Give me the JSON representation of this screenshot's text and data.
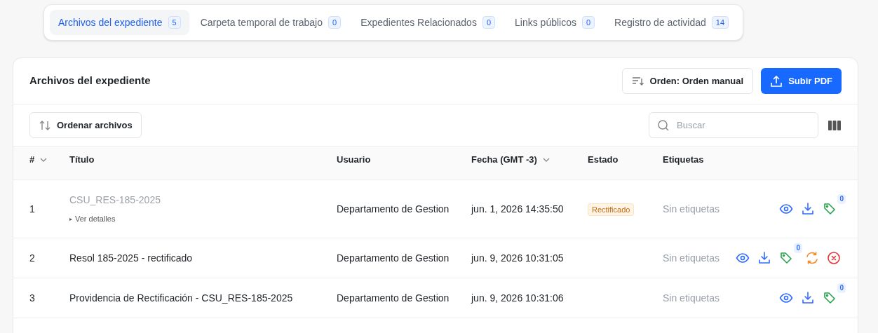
{
  "tabs": [
    {
      "label": "Archivos del expediente",
      "count": "5",
      "selected": true
    },
    {
      "label": "Carpeta temporal de trabajo",
      "count": "0",
      "selected": false
    },
    {
      "label": "Expedientes Relacionados",
      "count": "0",
      "selected": false
    },
    {
      "label": "Links públicos",
      "count": "0",
      "selected": false
    },
    {
      "label": "Registro de actividad",
      "count": "14",
      "selected": false
    }
  ],
  "panel": {
    "title": "Archivos del expediente",
    "order_button": "Orden: Orden manual",
    "upload_button": "Subir PDF",
    "sort_files_button": "Ordenar archivos",
    "search": {
      "placeholder": "Buscar"
    }
  },
  "table": {
    "columns": [
      {
        "label": "#",
        "sortable": true
      },
      {
        "label": "Título",
        "sortable": false
      },
      {
        "label": "Usuario",
        "sortable": false
      },
      {
        "label": "Fecha (GMT -3)",
        "sortable": true
      },
      {
        "label": "Estado",
        "sortable": false
      },
      {
        "label": "Etiquetas",
        "sortable": false
      }
    ],
    "rows": [
      {
        "number": "1",
        "title": "CSU_RES-185-2025",
        "muted": true,
        "details": {
          "icon": "▸",
          "label": "Ver detalles"
        },
        "user": "Departamento de Gestion",
        "date": "jun. 1, 2026 14:35:50",
        "status": "Rectificado",
        "tags": "Sin etiquetas",
        "tag_count": "0",
        "actions": [
          {
            "kind": "view"
          },
          {
            "kind": "download"
          },
          {
            "kind": "tag"
          }
        ]
      },
      {
        "number": "2",
        "title": "Resol 185-2025 - rectificado",
        "muted": false,
        "user": "Departamento de Gestion",
        "date": "jun. 9, 2026 10:31:05",
        "tags": "Sin etiquetas",
        "tag_count": "0",
        "actions": [
          {
            "kind": "view"
          },
          {
            "kind": "download"
          },
          {
            "kind": "tag"
          },
          {
            "kind": "replace"
          },
          {
            "kind": "delete"
          }
        ]
      },
      {
        "number": "3",
        "title": "Providencia de Rectificación - CSU_RES-185-2025",
        "muted": false,
        "user": "Departamento de Gestion",
        "date": "jun. 9, 2026 10:31:06",
        "tags": "Sin etiquetas",
        "tag_count": "0",
        "actions": [
          {
            "kind": "view"
          },
          {
            "kind": "download"
          },
          {
            "kind": "tag"
          }
        ]
      }
    ]
  }
}
